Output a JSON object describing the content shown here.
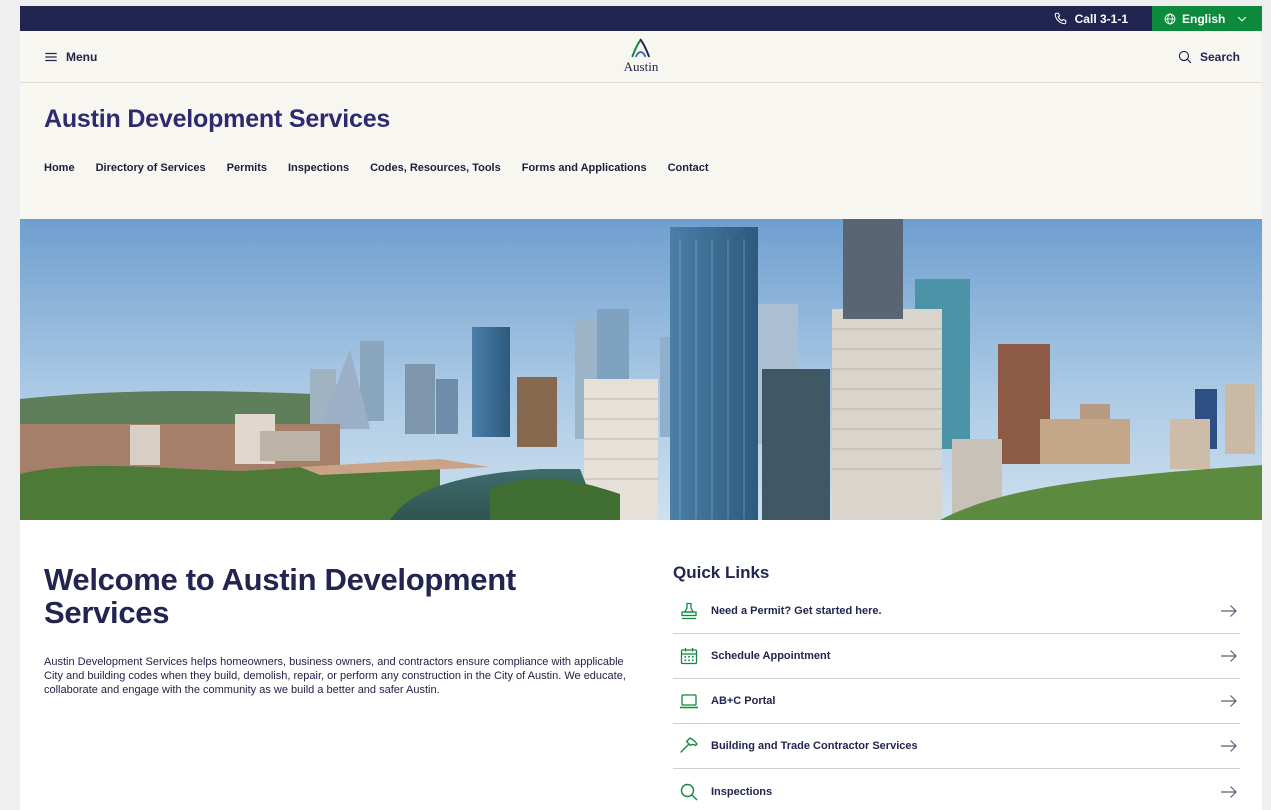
{
  "utility": {
    "call_label": "Call 3-1-1",
    "language_label": "English"
  },
  "header": {
    "menu_label": "Menu",
    "logo_text": "Austin",
    "search_label": "Search"
  },
  "site": {
    "title": "Austin Development Services"
  },
  "nav": [
    "Home",
    "Directory of Services",
    "Permits",
    "Inspections",
    "Codes, Resources, Tools",
    "Forms and Applications",
    "Contact"
  ],
  "welcome": {
    "heading": "Welcome to Austin Development Services",
    "body": "Austin Development Services helps homeowners, business owners, and contractors ensure compliance with applicable City and building codes when they build, demolish, repair, or perform any construction in the City of Austin. We educate, collaborate and engage with the community as we build a better and safer Austin."
  },
  "quick_links": {
    "heading": "Quick Links",
    "items": [
      {
        "label": "Need a Permit? Get started here.",
        "icon": "stamp-icon"
      },
      {
        "label": "Schedule Appointment",
        "icon": "calendar-icon"
      },
      {
        "label": "AB+C Portal",
        "icon": "laptop-icon"
      },
      {
        "label": "Building and Trade Contractor Services",
        "icon": "hammer-icon"
      },
      {
        "label": "Inspections",
        "icon": "magnifier-icon"
      }
    ]
  },
  "colors": {
    "navy": "#22254f",
    "brand_green": "#0d8a3c",
    "cream": "#f8f6f1",
    "title_purple": "#2e2a6f"
  }
}
